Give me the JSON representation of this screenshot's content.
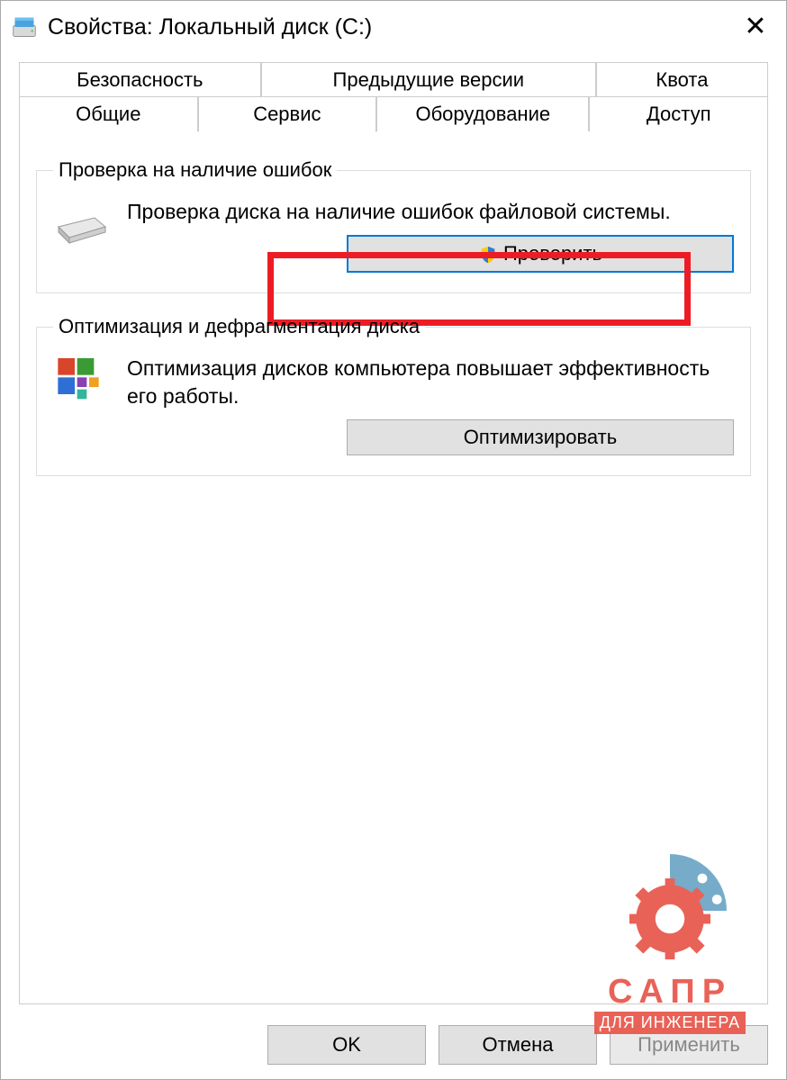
{
  "window": {
    "title": "Свойства: Локальный диск (C:)"
  },
  "tabs": {
    "row1": [
      "Безопасность",
      "Предыдущие версии",
      "Квота"
    ],
    "row2": [
      "Общие",
      "Сервис",
      "Оборудование",
      "Доступ"
    ],
    "active": "Сервис"
  },
  "group_check": {
    "legend": "Проверка на наличие ошибок",
    "text": "Проверка диска на наличие ошибок файловой системы.",
    "button": "Проверить"
  },
  "group_optimize": {
    "legend": "Оптимизация и дефрагментация диска",
    "text": "Оптимизация дисков компьютера повышает эффективность его работы.",
    "button": "Оптимизировать"
  },
  "footer": {
    "ok": "OK",
    "cancel": "Отмена",
    "apply": "Применить"
  },
  "watermark": {
    "line1": "САПР",
    "line2": "ДЛЯ ИНЖЕНЕРА"
  }
}
